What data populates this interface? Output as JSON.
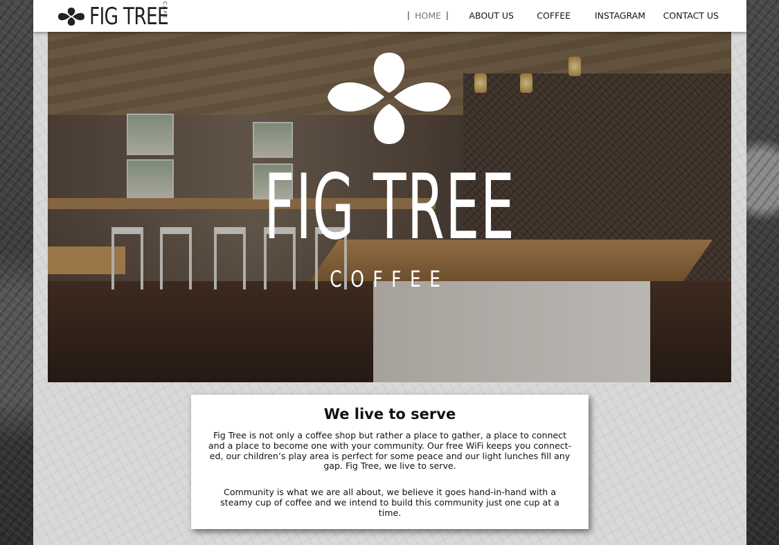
{
  "brand": {
    "name": "FIG TREE",
    "sub": "CAFE"
  },
  "nav": {
    "items": [
      {
        "label": "HOME",
        "active": true
      },
      {
        "label": "ABOUT US",
        "active": false
      },
      {
        "label": "COFFEE",
        "active": false
      },
      {
        "label": "INSTAGRAM",
        "active": false
      },
      {
        "label": "CONTACT US",
        "active": false
      }
    ],
    "separator": "|"
  },
  "hero": {
    "title": "FIG TREE",
    "subtitle": "COFFEE"
  },
  "intro": {
    "heading": "We live to serve",
    "paragraph1": "Fig Tree is not only a coffee shop but rather a place to gather, a place to connect and a place to become one with your community. Our free WiFi keeps you connect-ed, our children’s play area is perfect for some peace and our light lunches fill any gap. Fig Tree, we live to serve.",
    "paragraph2": "Community is what we are all about, we believe it goes hand-in-hand with a steamy cup of coffee and we intend to build this community just one cup at a time."
  },
  "icons": {
    "brand_logo": "fig-leaf-logo-icon",
    "hero_logo": "fig-leaf-logo-icon"
  },
  "colors": {
    "nav_active": "#777777",
    "text": "#111111",
    "card": "#ffffff"
  }
}
